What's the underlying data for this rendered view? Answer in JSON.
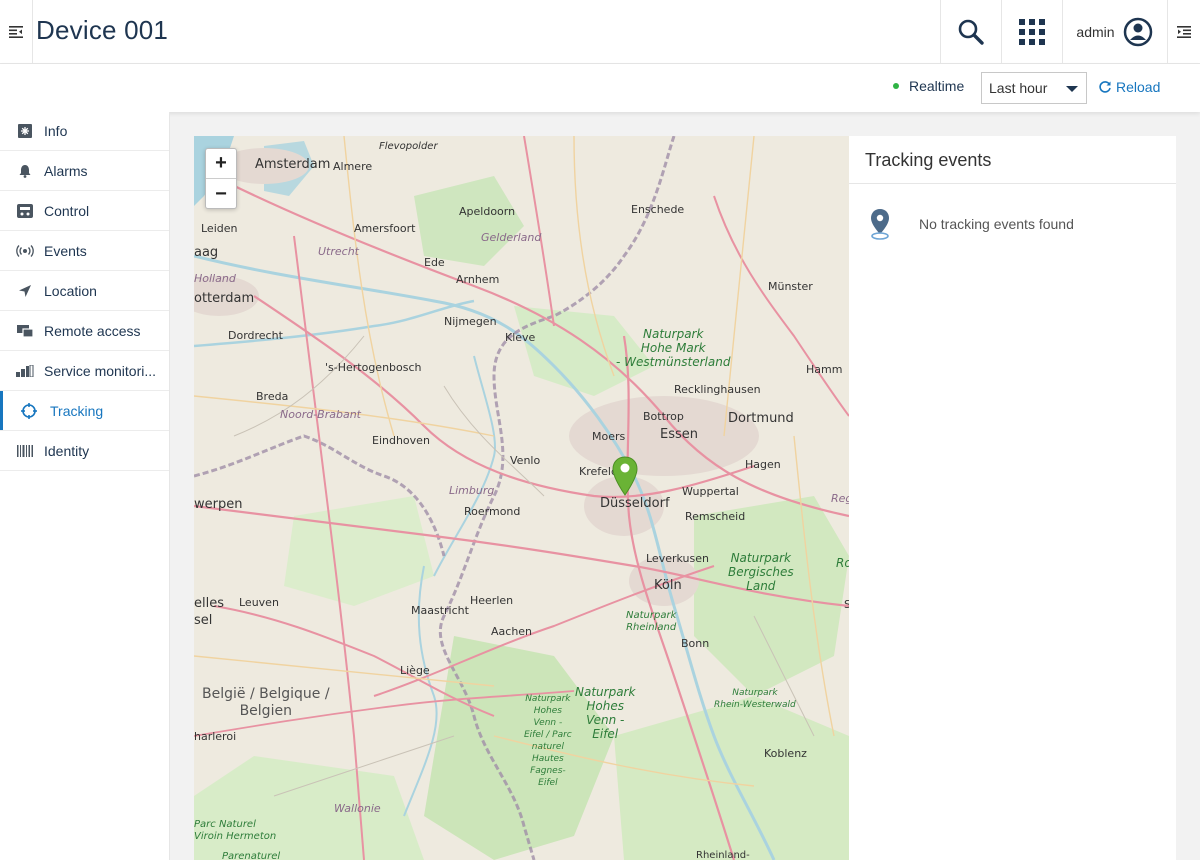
{
  "header": {
    "title": "Device 001",
    "user": "admin"
  },
  "toolbar": {
    "realtime_label": "Realtime",
    "range_selected": "Last hour",
    "reload_label": "Reload"
  },
  "sidebar": {
    "items": [
      {
        "label": "Info",
        "icon": "info-icon"
      },
      {
        "label": "Alarms",
        "icon": "bell-icon"
      },
      {
        "label": "Control",
        "icon": "control-icon"
      },
      {
        "label": "Events",
        "icon": "broadcast-icon"
      },
      {
        "label": "Location",
        "icon": "location-arrow-icon"
      },
      {
        "label": "Remote access",
        "icon": "remote-access-icon"
      },
      {
        "label": "Service monitori...",
        "icon": "signal-bars-icon"
      },
      {
        "label": "Tracking",
        "icon": "crosshair-icon"
      },
      {
        "label": "Identity",
        "icon": "barcode-icon"
      }
    ]
  },
  "map": {
    "zoom_in": "+",
    "zoom_out": "−",
    "labels": {
      "amsterdam": "Amsterdam",
      "almere": "Almere",
      "flevopolder": "Flevopolder",
      "enschede": "Enschede",
      "apeldoorn": "Apeldoorn",
      "leiden": "Leiden",
      "amersfoort": "Amersfoort",
      "gelderland": "Gelderland",
      "aag": "aag",
      "utrecht": "Utrecht",
      "ede": "Ede",
      "holland": "Holland",
      "arnhem": "Arnhem",
      "otterdam": "otterdam",
      "munster": "Münster",
      "nijmegen": "Nijmegen",
      "kleve": "Kleve",
      "dordrecht": "Dordrecht",
      "np_hohe_mark": "Naturpark\nHohe Mark\n- Westmünsterland",
      "hertogenbosch": "'s-Hertogenbosch",
      "hamm": "Hamm",
      "recklinghausen": "Recklinghausen",
      "breda": "Breda",
      "bottrop": "Bottrop",
      "dortmund": "Dortmund",
      "noord_brabant": "Noord-Brabant",
      "moers": "Moers",
      "essen": "Essen",
      "eindhoven": "Eindhoven",
      "venlo": "Venlo",
      "hagen": "Hagen",
      "krefeld": "Krefeld",
      "limburg": "Limburg",
      "wuppertal": "Wuppertal",
      "reg": "Reg",
      "werpen": "werpen",
      "dusseldorf": "Düsseldorf",
      "roermond": "Roermond",
      "remscheid": "Remscheid",
      "leverkusen": "Leverkusen",
      "np_bergisches": "Naturpark\nBergisches\nLand",
      "ro": "Ro",
      "koln": "Köln",
      "elles": "elles",
      "leuven": "Leuven",
      "heerlen": "Heerlen",
      "maastricht": "Maastricht",
      "sel": "sel",
      "np_rheinland": "Naturpark\nRheinland",
      "aachen": "Aachen",
      "bonn": "Bonn",
      "s": "S",
      "liege": "Liège",
      "belgie": "België / Belgique /\nBelgien",
      "np_hohes_venn": "Naturpark\nHohes\nVenn -\nEifel",
      "np_venn_eifel": "Naturpark\nHohes\nVenn -\nEifel / Parc\nnaturel\nHautes\nFagnes-\nEifel",
      "np_rhein_westerwald": "Naturpark\nRhein-Westerwald",
      "harleroi": "harleroi",
      "koblenz": "Koblenz",
      "wallonie": "Wallonie",
      "parc_naturel": "Parc Naturel\nViroin Hermeton",
      "parenaturel": "Parenaturel",
      "rheinland": "Rheinland-"
    }
  },
  "tracking": {
    "title": "Tracking events",
    "empty_message": "No tracking events found"
  },
  "colors": {
    "accent": "#1776bf",
    "title": "#1e3550",
    "realtime_dot": "#2fb344",
    "marker": "#6ab335"
  }
}
